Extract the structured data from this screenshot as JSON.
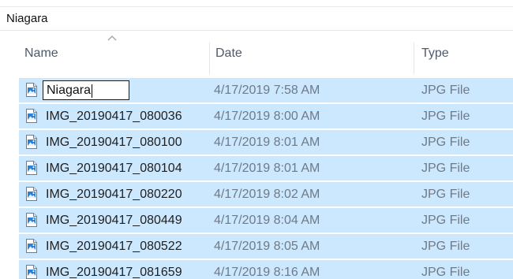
{
  "location": {
    "path": "Niagara"
  },
  "columns": {
    "name": "Name",
    "date": "Date",
    "type": "Type"
  },
  "rename_value": "Niagara",
  "files": [
    {
      "name": "Niagara",
      "date": "4/17/2019 7:58 AM",
      "type": "JPG File"
    },
    {
      "name": "IMG_20190417_080036",
      "date": "4/17/2019 8:00 AM",
      "type": "JPG File"
    },
    {
      "name": "IMG_20190417_080100",
      "date": "4/17/2019 8:01 AM",
      "type": "JPG File"
    },
    {
      "name": "IMG_20190417_080104",
      "date": "4/17/2019 8:01 AM",
      "type": "JPG File"
    },
    {
      "name": "IMG_20190417_080220",
      "date": "4/17/2019 8:02 AM",
      "type": "JPG File"
    },
    {
      "name": "IMG_20190417_080449",
      "date": "4/17/2019 8:04 AM",
      "type": "JPG File"
    },
    {
      "name": "IMG_20190417_080522",
      "date": "4/17/2019 8:05 AM",
      "type": "JPG File"
    },
    {
      "name": "IMG_20190417_081659",
      "date": "4/17/2019 8:16 AM",
      "type": "JPG File"
    }
  ],
  "icons": {
    "sort": "sort-ascending-icon",
    "file": "image-file-icon"
  },
  "colors": {
    "selection": "#cce8ff",
    "header_text": "#4d5a6b",
    "secondary_text": "#6f7a86"
  }
}
